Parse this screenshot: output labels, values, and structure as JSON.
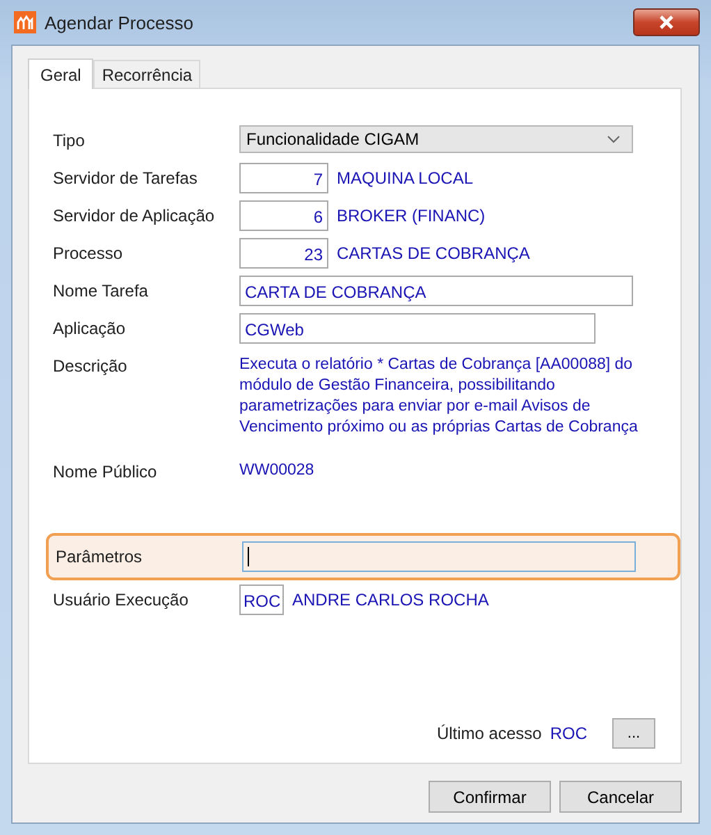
{
  "window": {
    "title": "Agendar Processo"
  },
  "tabs": [
    {
      "label": "Geral",
      "selected": true
    },
    {
      "label": "Recorrência",
      "selected": false
    }
  ],
  "fields": [
    {
      "kind": "select",
      "label": "Tipo",
      "value": "Funcionalidade CIGAM"
    },
    {
      "kind": "code",
      "label": "Servidor de Tarefas",
      "value": "7",
      "description": "MAQUINA LOCAL"
    },
    {
      "kind": "code",
      "label": "Servidor de Aplicação",
      "value": "6",
      "description": "BROKER (FINANC)"
    },
    {
      "kind": "code",
      "label": "Processo",
      "value": "23",
      "description": "CARTAS DE COBRANÇA"
    },
    {
      "kind": "text",
      "label": "Nome Tarefa",
      "value": "CARTA DE COBRANÇA"
    },
    {
      "kind": "short",
      "label": "Aplicação",
      "value": "CGWeb"
    },
    {
      "kind": "info",
      "label": "Descrição",
      "value": "Executa o relatório * Cartas de Cobrança [AA00088] do módulo de Gestão Financeira, possibilitando parametrizações para enviar por e-mail Avisos de Vencimento próximo ou as próprias Cartas de Cobrança"
    },
    {
      "kind": "info",
      "label": "Nome Público",
      "value": "WW00028"
    },
    {
      "kind": "gap"
    },
    {
      "kind": "param",
      "label": "Parâmetros",
      "highlighted": true
    },
    {
      "kind": "user",
      "label": "Usuário Execução",
      "value": "ROC",
      "description": "ANDRE CARLOS ROCHA"
    }
  ],
  "last_access": {
    "label": "Último acesso",
    "value": "ROC",
    "button": "..."
  },
  "buttons": [
    "Confirmar",
    "Cancelar"
  ]
}
